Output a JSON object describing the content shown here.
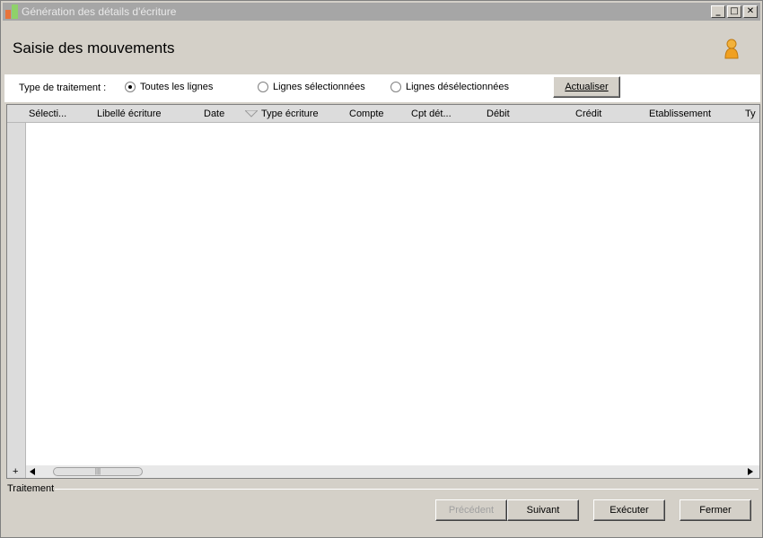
{
  "window": {
    "title": "Génération des détails d'écriture",
    "controls": {
      "minimize": "_",
      "maximize": "□",
      "close": "✕"
    }
  },
  "header": {
    "title": "Saisie des mouvements",
    "icon": "user-icon"
  },
  "filter": {
    "label": "Type de traitement :",
    "options": [
      {
        "label": "Toutes les lignes",
        "selected": true
      },
      {
        "label": "Lignes sélectionnées",
        "selected": false
      },
      {
        "label": "Lignes désélectionnées",
        "selected": false
      }
    ],
    "refresh_label": "Actualiser"
  },
  "grid": {
    "columns": [
      "Sélecti...",
      "Libellé écriture",
      "Date",
      "Type écriture",
      "Compte",
      "Cpt dét...",
      "Débit",
      "Crédit",
      "Etablissement",
      "Ty"
    ],
    "rows": [],
    "add_row": "+",
    "thumb_grip": "|||"
  },
  "status": {
    "label": "Traitement"
  },
  "footer": {
    "previous": "Précédent",
    "next": "Suivant",
    "execute": "Exécuter",
    "close": "Fermer"
  },
  "colors": {
    "titlebar": "#a6a6a6",
    "accent_user": "#f0a020"
  }
}
